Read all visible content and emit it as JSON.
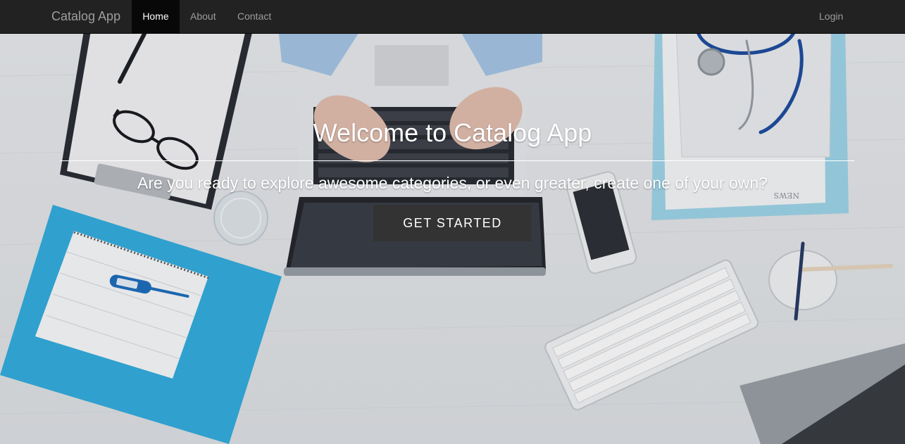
{
  "navbar": {
    "brand": "Catalog App",
    "links": [
      {
        "label": "Home",
        "active": true
      },
      {
        "label": "About",
        "active": false
      },
      {
        "label": "Contact",
        "active": false
      }
    ],
    "login_label": "Login",
    "background_color": "#222222",
    "active_background_color": "#080808"
  },
  "hero": {
    "title": "Welcome to Catalog App",
    "subtitle": "Are you ready to explore awesome categories, or even greater, create one of your own?",
    "cta_label": "GET STARTED",
    "cta_color": "#333333",
    "newspaper_text": "NEWS"
  }
}
